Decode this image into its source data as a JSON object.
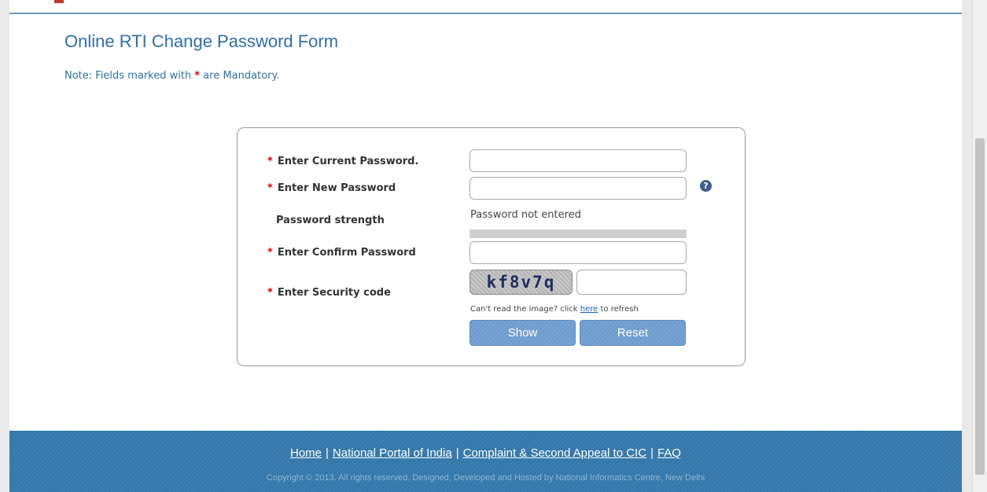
{
  "page": {
    "title": "Online RTI Change Password Form",
    "note_prefix": "Note: Fields marked with",
    "note_star": "*",
    "note_suffix": "are Mandatory."
  },
  "form": {
    "required_mark": "*",
    "current_password_label": "Enter Current Password.",
    "new_password_label": "Enter New Password",
    "strength_label": "Password strength",
    "strength_status": "Password not entered",
    "confirm_password_label": "Enter Confirm Password",
    "security_code_label": "Enter Security code",
    "captcha_text": "kf8v7q",
    "refresh_prefix": "Can't read the image? click",
    "refresh_link": "here",
    "refresh_suffix": "to refresh",
    "show_button": "Show",
    "reset_button": "Reset",
    "help_icon": "?"
  },
  "footer": {
    "links": [
      "Home",
      "National Portal of India",
      "Complaint & Second Appeal to CIC",
      "FAQ"
    ],
    "separator": "|",
    "copyright": "Copyright © 2013. All rights reserved. Designed, Developed and Hosted by National Informatics Centre, New Delhi"
  },
  "colors": {
    "title_blue": "#2f6fa4",
    "required_red": "#d00000",
    "button_blue": "#6d9bcd",
    "footer_blue": "#3476a7"
  }
}
